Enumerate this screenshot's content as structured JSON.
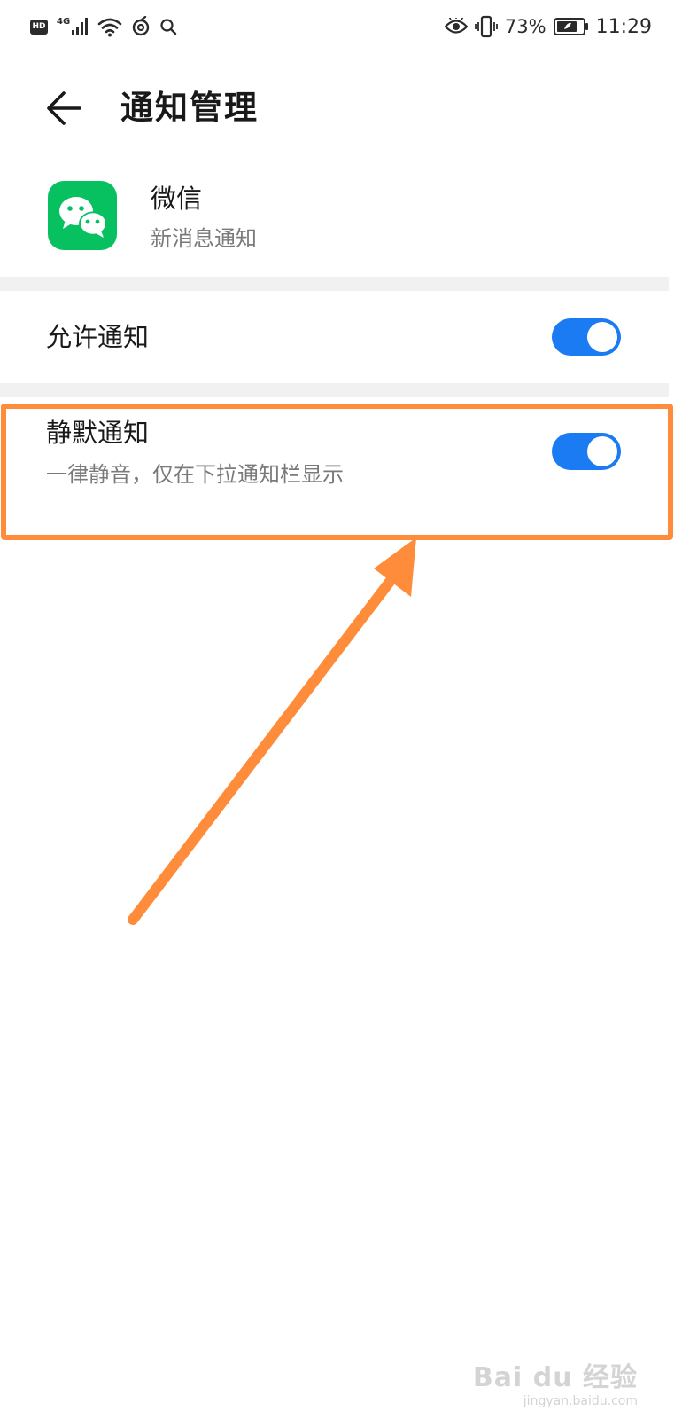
{
  "status_bar": {
    "hd_label": "HD",
    "network_label": "4G",
    "battery_percent": "73%",
    "time": "11:29",
    "icons": [
      "hd-icon",
      "signal-icon",
      "wifi-icon",
      "nfc-icon",
      "search-icon",
      "eye-comfort-icon",
      "vibrate-icon",
      "battery-icon"
    ]
  },
  "header": {
    "title": "通知管理",
    "back_icon": "arrow-left-icon"
  },
  "app": {
    "name": "微信",
    "subtitle": "新消息通知",
    "icon": "wechat-icon",
    "icon_color": "#07c160"
  },
  "settings": [
    {
      "label": "允许通知",
      "toggle_on": true
    },
    {
      "label": "静默通知",
      "description": "一律静音，仅在下拉通知栏显示",
      "toggle_on": true
    }
  ],
  "colors": {
    "toggle_on": "#1a7bf2",
    "annotation": "#ff8c3a",
    "divider": "#f1f1f1"
  },
  "watermark": {
    "main": "Bai du 经验",
    "sub": "jingyan.baidu.com"
  }
}
